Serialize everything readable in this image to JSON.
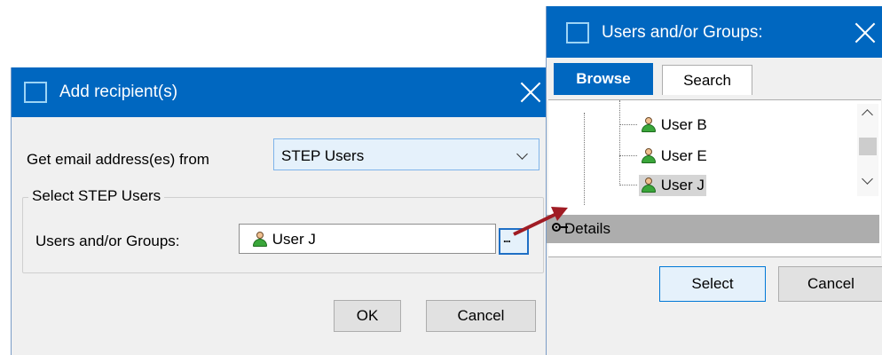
{
  "add_recipient": {
    "title": "Add recipient(s)",
    "source_label": "Get email address(es) from",
    "source_value": "STEP Users",
    "group_title": "Select STEP Users",
    "users_label": "Users and/or Groups:",
    "selected_user": "User J",
    "browse_button": "...",
    "ok_label": "OK",
    "cancel_label": "Cancel"
  },
  "users_dialog": {
    "title": "Users and/or Groups:",
    "tabs": [
      {
        "label": "Browse",
        "active": true
      },
      {
        "label": "Search",
        "active": false
      }
    ],
    "tree_items": [
      {
        "label": "User B",
        "selected": false
      },
      {
        "label": "User E",
        "selected": false
      },
      {
        "label": "User J",
        "selected": true
      }
    ],
    "details_label": "Details",
    "select_label": "Select",
    "cancel_label": "Cancel"
  },
  "colors": {
    "titlebar": "#0067c0",
    "arrow": "#a01c24",
    "button_focus": "#0078d7"
  },
  "icons": {
    "window": "window-icon",
    "close": "close-icon",
    "user": "user-icon",
    "dropdown": "chevron-down-icon",
    "details": "pin-icon"
  }
}
